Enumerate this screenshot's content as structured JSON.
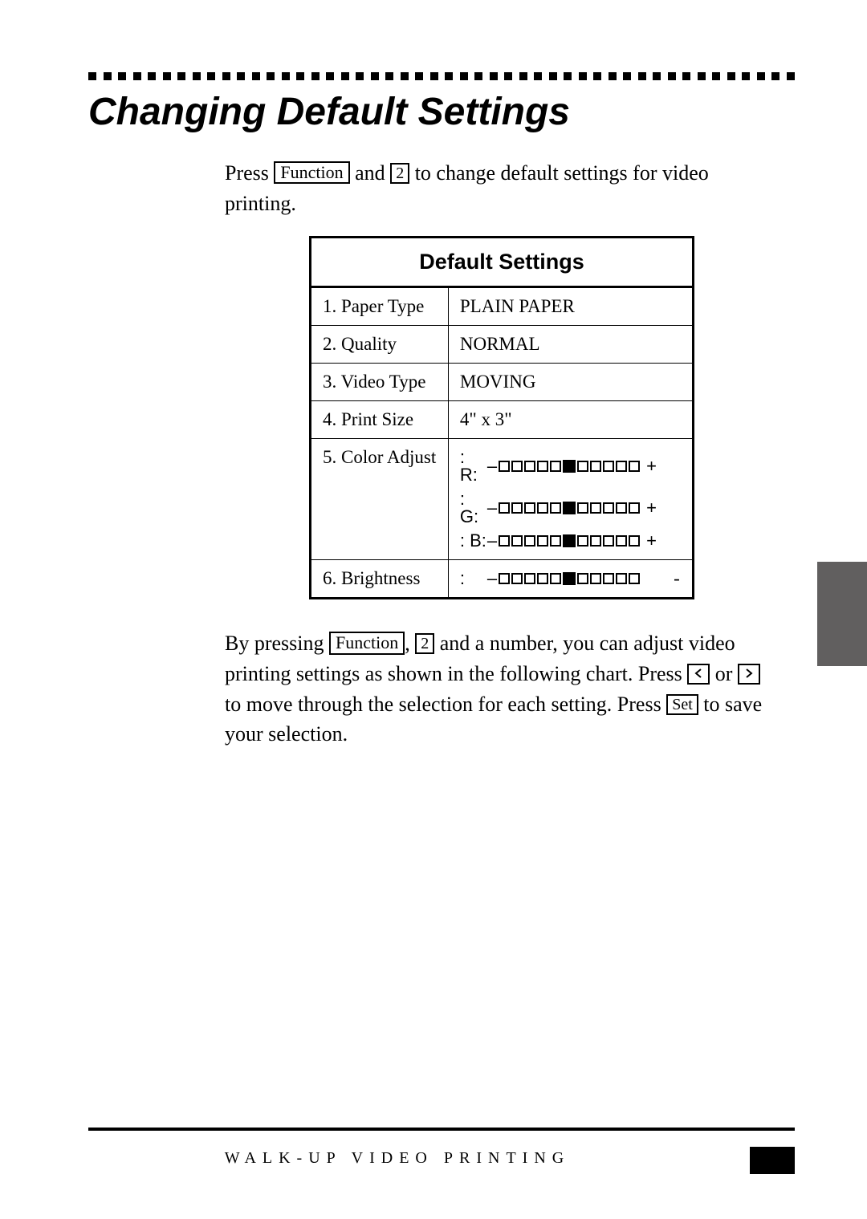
{
  "section_title": "Changing Default Settings",
  "intro": {
    "pre": "Press ",
    "key1": "Function",
    "mid": " and ",
    "key2": "2",
    "post": " to change default settings for video printing."
  },
  "table": {
    "header": "Default Settings",
    "rows": [
      {
        "label": "1. Paper Type",
        "value": "PLAIN PAPER"
      },
      {
        "label": "2. Quality",
        "value": "NORMAL"
      },
      {
        "label": "3. Video Type",
        "value": "MOVING"
      },
      {
        "label": "4. Print Size",
        "value": "4\" x 3\""
      },
      {
        "label": "5. Color Adjust",
        "value": ""
      },
      {
        "label": "6. Brightness",
        "value": ""
      }
    ],
    "color_channels": [
      {
        "left": ": R:",
        "plus": "+"
      },
      {
        "left": ": G:",
        "plus": "+"
      },
      {
        "left": ": B:",
        "plus": "+"
      }
    ],
    "brightness": {
      "left": ":",
      "right": "-"
    }
  },
  "para2": {
    "a": "By pressing ",
    "key1": "Function",
    "b": ", ",
    "key2": "2",
    "c": " and a number, you can adjust video printing settings as shown in the following chart. Press ",
    "d": " or ",
    "e": " to move through the selection for each setting. Press ",
    "keySet": "Set",
    "f": " to save your selection."
  },
  "footer": "WALK-UP VIDEO PRINTING"
}
